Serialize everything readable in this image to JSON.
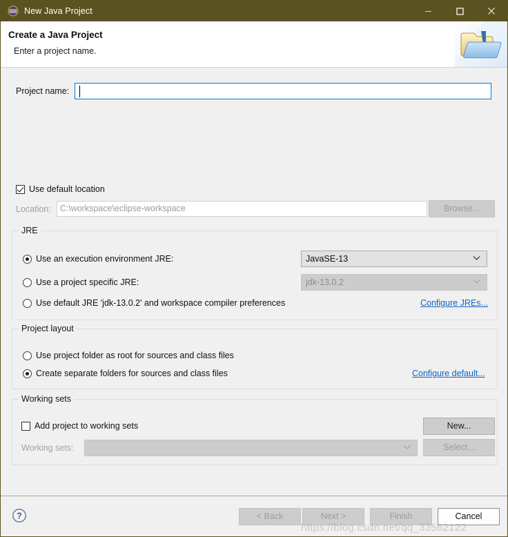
{
  "window": {
    "title": "New Java Project",
    "title_icon": "eclipse-java-icon",
    "titlebar_color": "#5b5221",
    "minimize_label": "—",
    "maximize_label": "☐",
    "close_label": "✕"
  },
  "header": {
    "title": "Create a Java Project",
    "subtitle": "Enter a project name.",
    "icon": "java-project-folder-icon"
  },
  "project": {
    "name_label": "Project name:",
    "name_value": "",
    "name_placeholder": "",
    "use_default_location_label": "Use default location",
    "use_default_location_checked": true,
    "location_label": "Location:",
    "location_value": "C:\\workspace\\eclipse-workspace",
    "browse_label": "Browse..."
  },
  "jre": {
    "group_title": "JRE",
    "options": [
      {
        "label": "Use an execution environment JRE:",
        "selected": true
      },
      {
        "label": "Use a project specific JRE:",
        "selected": false
      },
      {
        "label": "Use default JRE 'jdk-13.0.2' and workspace compiler preferences",
        "selected": false
      }
    ],
    "execution_env_value": "JavaSE-13",
    "project_jre_value": "jdk-13.0.2",
    "configure_link": "Configure JREs..."
  },
  "project_layout": {
    "group_title": "Project layout",
    "options": [
      {
        "label": "Use project folder as root for sources and class files",
        "selected": false
      },
      {
        "label": "Create separate folders for sources and class files",
        "selected": true
      }
    ],
    "configure_link": "Configure default..."
  },
  "working_sets": {
    "group_title": "Working sets",
    "add_label": "Add project to working sets",
    "add_checked": false,
    "sets_label": "Working sets:",
    "sets_value": "",
    "new_label": "New...",
    "select_label": "Select..."
  },
  "footer": {
    "help_label": "?",
    "back_label": "< Back",
    "next_label": "Next >",
    "finish_label": "Finish",
    "cancel_label": "Cancel"
  },
  "watermark": {
    "text": "https://blog.csdn.net/qq_33562122"
  },
  "colors": {
    "titlebar": "#5b5221",
    "accent_focus": "#0078d7",
    "link": "#0a63c9",
    "dialog_bg": "#f0f0f0"
  }
}
